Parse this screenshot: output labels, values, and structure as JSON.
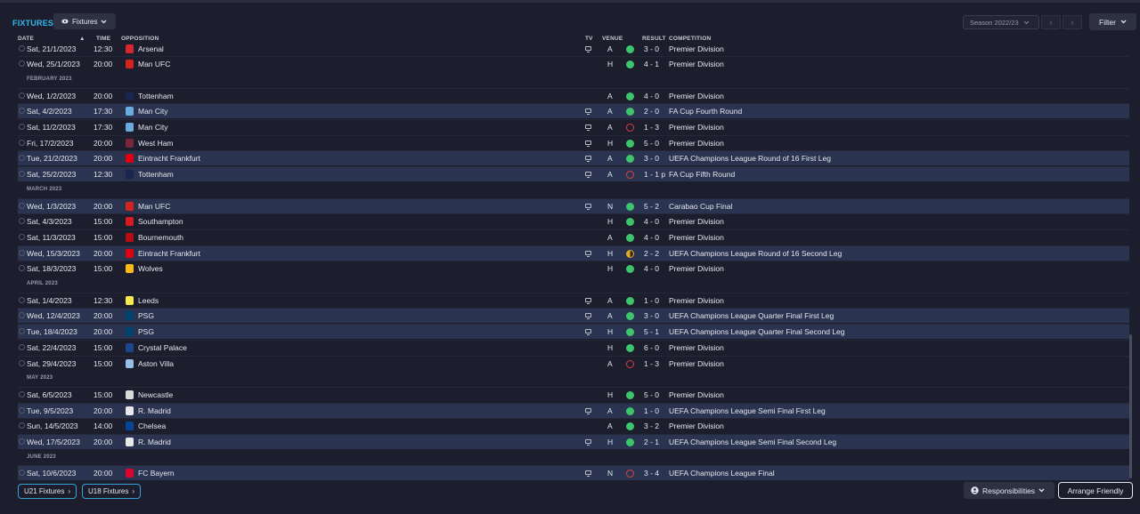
{
  "header": {
    "title": "FIXTURES",
    "view_label": "Fixtures",
    "season_label": "Season 2022/23",
    "filter_label": "Filter"
  },
  "columns": {
    "date": "DATE",
    "time": "TIME",
    "opposition": "OPPOSITION",
    "tv": "TV",
    "venue": "VENUE",
    "result": "RESULT",
    "competition": "COMPETITION"
  },
  "months": [
    "FEBRUARY 2023",
    "MARCH 2023",
    "APRIL 2023",
    "MAY 2023",
    "JUNE 2023"
  ],
  "fixtures": [
    {
      "date": "Sat, 21/1/2023",
      "time": "12:30",
      "opp": "Arsenal",
      "venue": "A",
      "outcome": "win",
      "score": "3 - 0",
      "comp": "Premier Division",
      "tv": true,
      "highlight": false,
      "crest": "#d6262f"
    },
    {
      "date": "Wed, 25/1/2023",
      "time": "20:00",
      "opp": "Man UFC",
      "venue": "H",
      "outcome": "win",
      "score": "4 - 1",
      "comp": "Premier Division",
      "tv": false,
      "highlight": false,
      "crest": "#d3241d"
    },
    {
      "date": "Wed, 1/2/2023",
      "time": "20:00",
      "opp": "Tottenham",
      "venue": "A",
      "outcome": "win",
      "score": "4 - 0",
      "comp": "Premier Division",
      "tv": false,
      "highlight": false,
      "crest": "#1a2450"
    },
    {
      "date": "Sat, 4/2/2023",
      "time": "17:30",
      "opp": "Man City",
      "venue": "A",
      "outcome": "win",
      "score": "2 - 0",
      "comp": "FA Cup Fourth Round",
      "tv": true,
      "highlight": true,
      "crest": "#6cabdd"
    },
    {
      "date": "Sat, 11/2/2023",
      "time": "17:30",
      "opp": "Man City",
      "venue": "A",
      "outcome": "loss",
      "score": "1 - 3",
      "comp": "Premier Division",
      "tv": true,
      "highlight": false,
      "crest": "#6cabdd"
    },
    {
      "date": "Fri, 17/2/2023",
      "time": "20:00",
      "opp": "West Ham",
      "venue": "H",
      "outcome": "win",
      "score": "5 - 0",
      "comp": "Premier Division",
      "tv": true,
      "highlight": false,
      "crest": "#7a263a"
    },
    {
      "date": "Tue, 21/2/2023",
      "time": "20:00",
      "opp": "Eintracht Frankfurt",
      "venue": "A",
      "outcome": "win",
      "score": "3 - 0",
      "comp": "UEFA Champions League Round of 16 First Leg",
      "tv": true,
      "highlight": true,
      "crest": "#e1000f"
    },
    {
      "date": "Sat, 25/2/2023",
      "time": "12:30",
      "opp": "Tottenham",
      "venue": "A",
      "outcome": "loss",
      "score": "1 - 1 p",
      "comp": "FA Cup Fifth Round",
      "tv": true,
      "highlight": true,
      "crest": "#1a2450"
    },
    {
      "date": "Wed, 1/3/2023",
      "time": "20:00",
      "opp": "Man UFC",
      "venue": "N",
      "outcome": "win",
      "score": "5 - 2",
      "comp": "Carabao Cup Final",
      "tv": true,
      "highlight": true,
      "crest": "#d3241d"
    },
    {
      "date": "Sat, 4/3/2023",
      "time": "15:00",
      "opp": "Southampton",
      "venue": "H",
      "outcome": "win",
      "score": "4 - 0",
      "comp": "Premier Division",
      "tv": false,
      "highlight": false,
      "crest": "#d71920"
    },
    {
      "date": "Sat, 11/3/2023",
      "time": "15:00",
      "opp": "Bournemouth",
      "venue": "A",
      "outcome": "win",
      "score": "4 - 0",
      "comp": "Premier Division",
      "tv": false,
      "highlight": false,
      "crest": "#b50e12"
    },
    {
      "date": "Wed, 15/3/2023",
      "time": "20:00",
      "opp": "Eintracht Frankfurt",
      "venue": "H",
      "outcome": "draw",
      "score": "2 - 2",
      "comp": "UEFA Champions League Round of 16 Second Leg",
      "tv": true,
      "highlight": true,
      "crest": "#e1000f"
    },
    {
      "date": "Sat, 18/3/2023",
      "time": "15:00",
      "opp": "Wolves",
      "venue": "H",
      "outcome": "win",
      "score": "4 - 0",
      "comp": "Premier Division",
      "tv": false,
      "highlight": false,
      "crest": "#fdb913"
    },
    {
      "date": "Sat, 1/4/2023",
      "time": "12:30",
      "opp": "Leeds",
      "venue": "A",
      "outcome": "win",
      "score": "1 - 0",
      "comp": "Premier Division",
      "tv": true,
      "highlight": false,
      "crest": "#f5e94d"
    },
    {
      "date": "Wed, 12/4/2023",
      "time": "20:00",
      "opp": "PSG",
      "venue": "A",
      "outcome": "win",
      "score": "3 - 0",
      "comp": "UEFA Champions League Quarter Final First Leg",
      "tv": true,
      "highlight": true,
      "crest": "#004170"
    },
    {
      "date": "Tue, 18/4/2023",
      "time": "20:00",
      "opp": "PSG",
      "venue": "H",
      "outcome": "win",
      "score": "5 - 1",
      "comp": "UEFA Champions League Quarter Final Second Leg",
      "tv": true,
      "highlight": true,
      "crest": "#004170"
    },
    {
      "date": "Sat, 22/4/2023",
      "time": "15:00",
      "opp": "Crystal Palace",
      "venue": "H",
      "outcome": "win",
      "score": "6 - 0",
      "comp": "Premier Division",
      "tv": false,
      "highlight": false,
      "crest": "#1b458f"
    },
    {
      "date": "Sat, 29/4/2023",
      "time": "15:00",
      "opp": "Aston Villa",
      "venue": "A",
      "outcome": "loss",
      "score": "1 - 3",
      "comp": "Premier Division",
      "tv": false,
      "highlight": false,
      "crest": "#95bfe5"
    },
    {
      "date": "Sat, 6/5/2023",
      "time": "15:00",
      "opp": "Newcastle",
      "venue": "H",
      "outcome": "win",
      "score": "5 - 0",
      "comp": "Premier Division",
      "tv": false,
      "highlight": false,
      "crest": "#d9d9d9"
    },
    {
      "date": "Tue, 9/5/2023",
      "time": "20:00",
      "opp": "R. Madrid",
      "venue": "A",
      "outcome": "win",
      "score": "1 - 0",
      "comp": "UEFA Champions League Semi Final First Leg",
      "tv": true,
      "highlight": true,
      "crest": "#e8e8e8"
    },
    {
      "date": "Sun, 14/5/2023",
      "time": "14:00",
      "opp": "Chelsea",
      "venue": "A",
      "outcome": "win",
      "score": "3 - 2",
      "comp": "Premier Division",
      "tv": false,
      "highlight": false,
      "crest": "#034694"
    },
    {
      "date": "Wed, 17/5/2023",
      "time": "20:00",
      "opp": "R. Madrid",
      "venue": "H",
      "outcome": "win",
      "score": "2 - 1",
      "comp": "UEFA Champions League Semi Final Second Leg",
      "tv": true,
      "highlight": true,
      "crest": "#e8e8e8"
    },
    {
      "date": "Sat, 10/6/2023",
      "time": "20:00",
      "opp": "FC Bayern",
      "venue": "N",
      "outcome": "loss",
      "score": "3 - 4",
      "comp": "UEFA Champions League Final",
      "tv": true,
      "highlight": true,
      "crest": "#dc052d"
    }
  ],
  "footer": {
    "u21_label": "U21 Fixtures",
    "u18_label": "U18 Fixtures",
    "responsibilities_label": "Responsibilities",
    "arrange_label": "Arrange Friendly"
  }
}
